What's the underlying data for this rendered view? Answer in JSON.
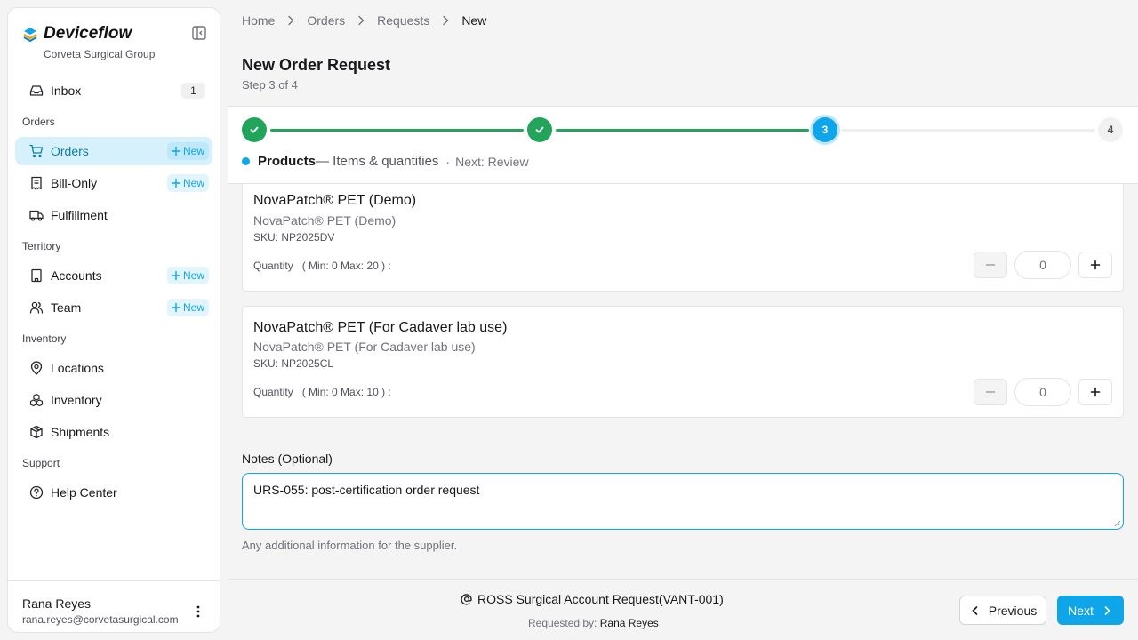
{
  "colors": {
    "accent": "#0ea5e9",
    "success": "#22a55a",
    "active_bg": "#d6f1fb"
  },
  "sidebar": {
    "brand": "Deviceflow",
    "org": "Corveta Surgical Group",
    "inbox": {
      "label": "Inbox",
      "count": "1",
      "icon": "inbox-icon"
    },
    "sections": {
      "orders": "Orders",
      "territory": "Territory",
      "inventory": "Inventory",
      "support": "Support"
    },
    "items": {
      "orders": {
        "label": "Orders",
        "new_label": "New",
        "icon": "cart-icon",
        "active": true
      },
      "bill_only": {
        "label": "Bill-Only",
        "new_label": "New",
        "icon": "receipt-icon"
      },
      "fulfillment": {
        "label": "Fulfillment",
        "icon": "truck-icon"
      },
      "accounts": {
        "label": "Accounts",
        "new_label": "New",
        "icon": "building-icon"
      },
      "team": {
        "label": "Team",
        "new_label": "New",
        "icon": "users-icon"
      },
      "locations": {
        "label": "Locations",
        "icon": "map-pin-icon"
      },
      "inventory": {
        "label": "Inventory",
        "icon": "boxes-icon"
      },
      "shipments": {
        "label": "Shipments",
        "icon": "package-icon"
      },
      "help": {
        "label": "Help Center",
        "icon": "help-circle-icon"
      }
    },
    "user": {
      "name": "Rana Reyes",
      "email": "rana.reyes@corvetasurgical.com"
    }
  },
  "breadcrumb": [
    "Home",
    "Orders",
    "Requests",
    "New"
  ],
  "page": {
    "title": "New Order Request",
    "subtitle": "Step 3 of 4"
  },
  "stepper": {
    "current_number": "3",
    "last_number": "4",
    "current_title": "Products",
    "current_desc": "— Items & quantities",
    "separator": "·",
    "next": "Next: Review"
  },
  "products": [
    {
      "name": "NovaPatch® PET (Demo)",
      "subtitle": "NovaPatch® PET (Demo)",
      "sku": "SKU: NP2025DV",
      "quantity_label": "Quantity",
      "limits": "( Min: 0 Max: 20 ) :",
      "value": "0"
    },
    {
      "name": "NovaPatch® PET (For Cadaver lab use)",
      "subtitle": "NovaPatch® PET (For Cadaver lab use)",
      "sku": "SKU: NP2025CL",
      "quantity_label": "Quantity",
      "limits": "( Min: 0 Max: 10 ) :",
      "value": "0"
    }
  ],
  "notes": {
    "label": "Notes (Optional)",
    "value": "URS-055: post-certification order request",
    "help": "Any additional information for the supplier."
  },
  "footer": {
    "account": "ROSS Surgical Account Request(VANT-001)",
    "requested_by_label": "Requested by:",
    "requested_by_name": "Rana Reyes",
    "prev_label": "Previous",
    "next_label": "Next"
  }
}
